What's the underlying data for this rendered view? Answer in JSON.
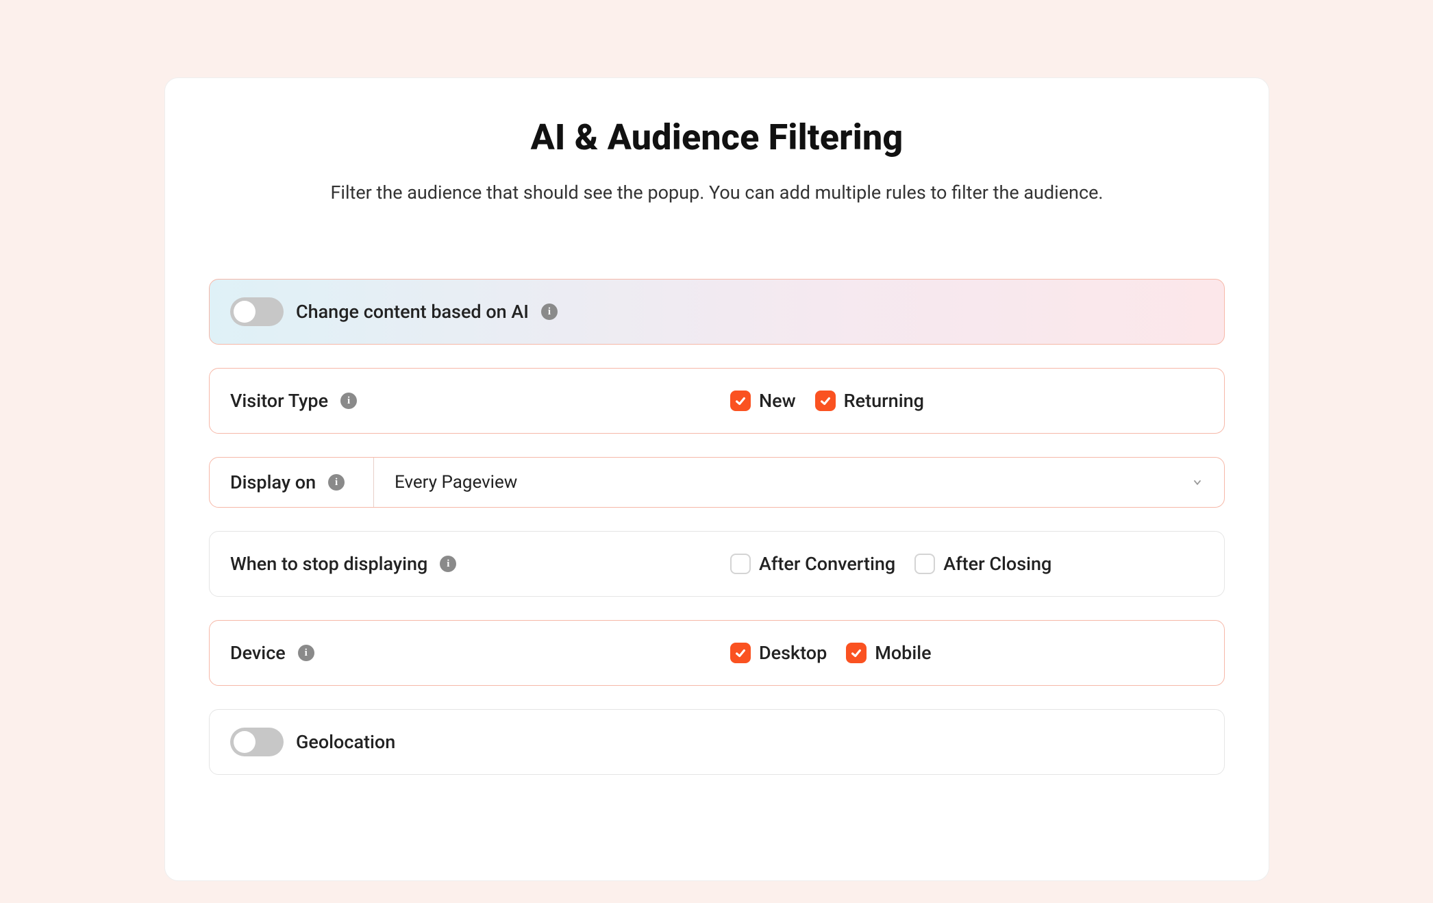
{
  "title": "AI & Audience Filtering",
  "subtitle": "Filter the audience that should see the popup. You can add multiple rules to filter the audience.",
  "rows": {
    "ai": {
      "label": "Change content based on AI"
    },
    "visitor_type": {
      "label": "Visitor Type",
      "options": {
        "new": "New",
        "returning": "Returning"
      }
    },
    "display_on": {
      "label": "Display on",
      "value": "Every Pageview"
    },
    "stop": {
      "label": "When to stop displaying",
      "options": {
        "after_converting": "After Converting",
        "after_closing": "After Closing"
      }
    },
    "device": {
      "label": "Device",
      "options": {
        "desktop": "Desktop",
        "mobile": "Mobile"
      }
    },
    "geolocation": {
      "label": "Geolocation"
    }
  }
}
